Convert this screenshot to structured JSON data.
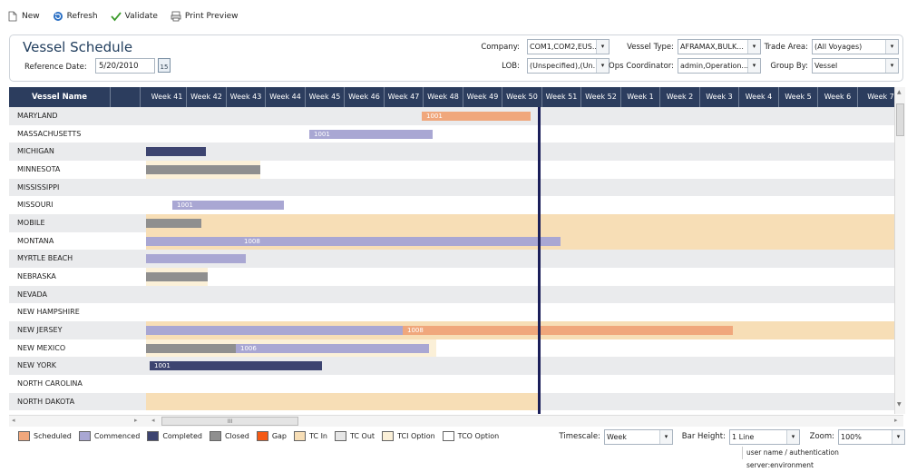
{
  "toolbar": {
    "new_label": "New",
    "refresh_label": "Refresh",
    "validate_label": "Validate",
    "print_label": "Print Preview"
  },
  "header": {
    "title": "Vessel Schedule",
    "ref_date_label": "Reference Date:",
    "ref_date_value": "5/20/2010",
    "calendar_day": "15",
    "company_label": "Company:",
    "company_value": "COM1,COM2,EUS...",
    "lob_label": "LOB:",
    "lob_value": "(Unspecified),(Un...",
    "vessel_type_label": "Vessel Type:",
    "vessel_type_value": "AFRAMAX,BULK...",
    "ops_coord_label": "Ops Coordinator:",
    "ops_coord_value": "admin,Operation...",
    "trade_area_label": "Trade Area:",
    "trade_area_value": "(All Voyages)",
    "group_by_label": "Group By:",
    "group_by_value": "Vessel"
  },
  "grid": {
    "vessel_col_header": "Vessel Name",
    "weeks": [
      "Week 41",
      "Week 42",
      "Week 43",
      "Week 44",
      "Week 45",
      "Week 46",
      "Week 47",
      "Week 48",
      "Week 49",
      "Week 50",
      "Week 51",
      "Week 52",
      "Week 1",
      "Week 2",
      "Week 3",
      "Week 4",
      "Week 5",
      "Week 6",
      "Week 7"
    ],
    "rows": [
      {
        "name": "MARYLAND"
      },
      {
        "name": "MASSACHUSETTS"
      },
      {
        "name": "MICHIGAN"
      },
      {
        "name": "MINNESOTA"
      },
      {
        "name": "MISSISSIPPI"
      },
      {
        "name": "MISSOURI"
      },
      {
        "name": "MOBILE"
      },
      {
        "name": "MONTANA"
      },
      {
        "name": "MYRTLE BEACH"
      },
      {
        "name": "NEBRASKA"
      },
      {
        "name": "NEVADA"
      },
      {
        "name": "NEW HAMPSHIRE"
      },
      {
        "name": "NEW JERSEY"
      },
      {
        "name": "NEW MEXICO"
      },
      {
        "name": "NEW YORK"
      },
      {
        "name": "NORTH CAROLINA"
      },
      {
        "name": "NORTH DAKOTA"
      }
    ],
    "bar_labels": {
      "maryland": "1001",
      "massachusetts": "1001",
      "missouri": "1001",
      "montana": "1008",
      "new_jersey": "1008",
      "new_mexico": "1006",
      "new_york": "1001"
    }
  },
  "hscroll": {
    "thumb_label": "III"
  },
  "legend": [
    {
      "label": "Scheduled",
      "color": "#f0a77c"
    },
    {
      "label": "Commenced",
      "color": "#a9a7d3"
    },
    {
      "label": "Completed",
      "color": "#3d4470"
    },
    {
      "label": "Closed",
      "color": "#8f8f8f"
    },
    {
      "label": "Gap",
      "color": "#f45a16"
    },
    {
      "label": "TC In",
      "color": "#f7deb6"
    },
    {
      "label": "TC Out",
      "color": "#e6e6e6"
    },
    {
      "label": "TCI Option",
      "color": "#fbf0d8"
    },
    {
      "label": "TCO Option",
      "color": "#ffffff"
    }
  ],
  "footer": {
    "timescale_label": "Timescale:",
    "timescale_value": "Week",
    "bar_height_label": "Bar Height:",
    "bar_height_value": "1 Line",
    "zoom_label": "Zoom:",
    "zoom_value": "100%",
    "status_text": "user name / authentication server:environment"
  }
}
